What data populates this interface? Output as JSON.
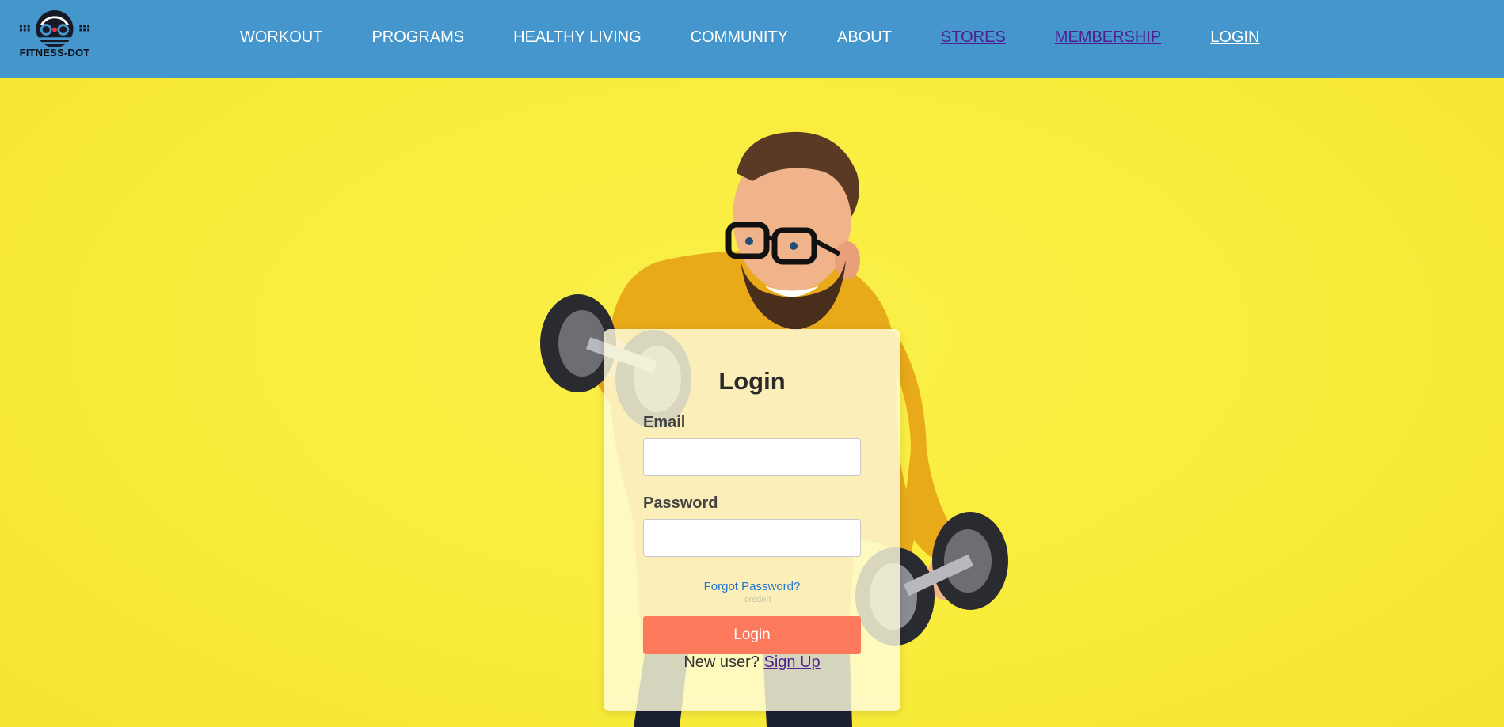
{
  "brand": {
    "name": "FITNESS-DOT"
  },
  "nav": {
    "items": [
      {
        "label": "WORKOUT"
      },
      {
        "label": "PROGRAMS"
      },
      {
        "label": "HEALTHY LIVING"
      },
      {
        "label": "COMMUNITY"
      },
      {
        "label": "ABOUT"
      },
      {
        "label": "STORES"
      },
      {
        "label": "MEMBERSHIP"
      },
      {
        "label": "LOGIN"
      }
    ]
  },
  "login": {
    "title": "Login",
    "email_label": "Email",
    "email_value": "",
    "password_label": "Password",
    "password_value": "",
    "forgot_label": "Forgot Password?",
    "hint_text": "creden",
    "submit_label": "Login",
    "new_user_text": "New user?",
    "signup_label": "Sign Up"
  },
  "colors": {
    "navbar": "#4596cc",
    "background": "#f9ec3b",
    "button": "#fd795b",
    "visited_link": "#4f1f8f"
  }
}
